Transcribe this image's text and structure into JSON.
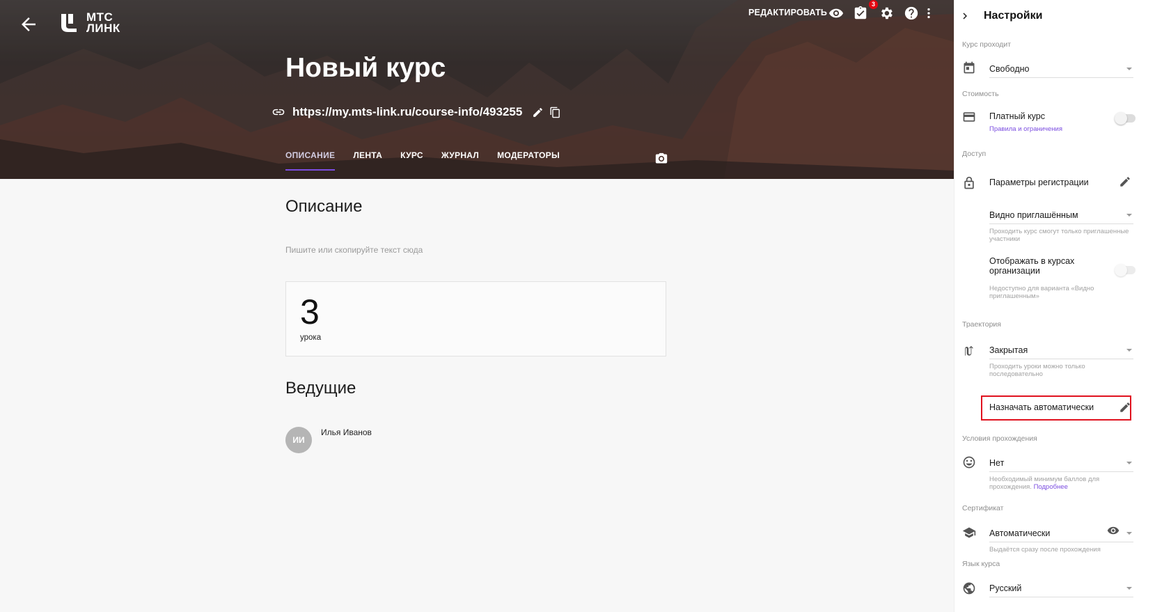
{
  "header": {
    "logo_line1": "МТС",
    "logo_line2": "ЛИНК",
    "edit_label": "РЕДАКТИРОВАТЬ",
    "tasks_badge": "3",
    "icons": [
      "back-arrow-icon",
      "eye-icon",
      "tasks-icon",
      "gear-icon",
      "help-icon",
      "more-vertical-icon"
    ]
  },
  "course": {
    "title": "Новый курс",
    "url": "https://my.mts-link.ru/course-info/493255"
  },
  "tabs": [
    {
      "label": "ОПИСАНИЕ",
      "active": true
    },
    {
      "label": "ЛЕНТА"
    },
    {
      "label": "КУРС"
    },
    {
      "label": "ЖУРНАЛ"
    },
    {
      "label": "МОДЕРАТОРЫ"
    }
  ],
  "description": {
    "heading": "Описание",
    "placeholder": "Пишите или скопируйте текст сюда",
    "lessons_count": "3",
    "lessons_label": "урока"
  },
  "hosts": {
    "heading": "Ведущие",
    "items": [
      {
        "initials": "ИИ",
        "name": "Илья Иванов"
      }
    ]
  },
  "settings": {
    "title": "Настройки",
    "passing": {
      "section": "Курс проходит",
      "value": "Свободно"
    },
    "cost": {
      "section": "Стоимость",
      "label": "Платный курс",
      "link": "Правила и ограничения",
      "enabled": false
    },
    "access": {
      "section": "Доступ",
      "registration": "Параметры регистрации",
      "visibility": "Видно приглашённым",
      "visibility_hint": "Проходить курс смогут только приглашенные участники",
      "show_in_org": "Отображать в курсах организации",
      "show_in_org_hint": "Недоступно для варианта «Видно приглашенным»"
    },
    "trajectory": {
      "section": "Траектория",
      "value": "Закрытая",
      "hint": "Проходить уроки можно только последовательно",
      "auto_assign": "Назначать автоматически"
    },
    "conditions": {
      "section": "Условия прохождения",
      "value": "Нет",
      "hint": "Необходимый минимум баллов для прохождения.",
      "hint_link": "Подробнее"
    },
    "certificate": {
      "section": "Сертификат",
      "value": "Автоматически",
      "hint": "Выдаётся сразу после прохождения"
    },
    "language": {
      "section": "Язык курса",
      "value": "Русский"
    },
    "colors": {
      "accent": "#7b4de0",
      "highlight": "#e0121f",
      "badge": "#e30611"
    }
  }
}
